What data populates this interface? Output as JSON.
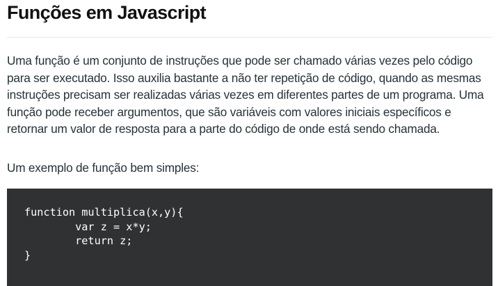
{
  "article": {
    "title": "Funções em Javascript",
    "intro": "Uma função é um conjunto de instruções que pode ser chamado várias vezes pelo código para ser executado. Isso auxilia bastante a não ter repetição de código, quando as mesmas instruções precisam ser realizadas várias vezes em diferentes partes de um programa. Uma função pode receber argumentos, que são variáveis com valores iniciais específicos e retornar um valor de resposta para a parte do código de onde está sendo chamada.",
    "example_lead": "Um exemplo de função bem simples:",
    "code_lines": [
      "function multiplica(x,y){",
      "        var z = x*y;",
      "        return z;",
      "}"
    ]
  },
  "colors": {
    "code_background": "#2f3133",
    "code_text": "#ffffff",
    "body_text": "#263238"
  }
}
